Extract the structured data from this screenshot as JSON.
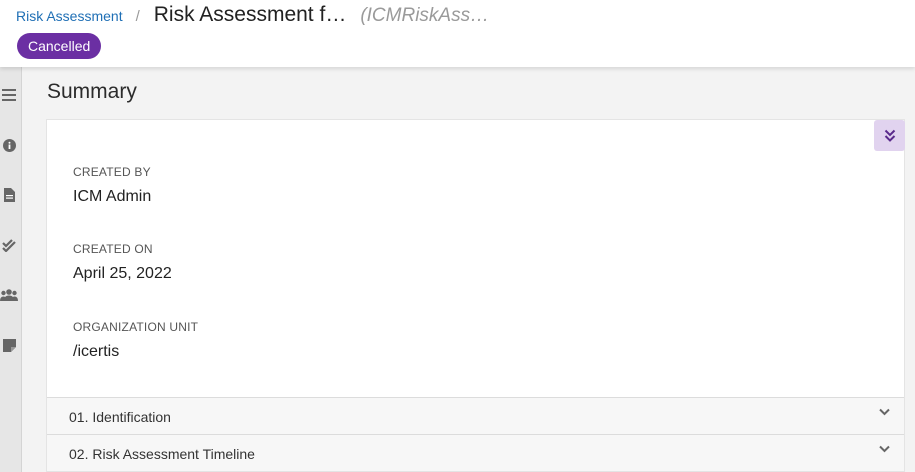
{
  "breadcrumb": {
    "parent_label": "Risk Assessment",
    "separator": "/",
    "title": "Risk Assessment f…",
    "subtitle": "(ICMRiskAss…"
  },
  "status": {
    "label": "Cancelled",
    "color": "#6b2fa3"
  },
  "left_rail": {
    "icons": [
      "menu-icon",
      "info-icon",
      "document-icon",
      "double-check-icon",
      "users-icon",
      "note-icon"
    ]
  },
  "summary": {
    "title": "Summary",
    "collapse_icon": "double-chevron-down-icon",
    "fields": [
      {
        "label": "CREATED BY",
        "value": "ICM Admin"
      },
      {
        "label": "CREATED ON",
        "value": "April 25, 2022"
      },
      {
        "label": "ORGANIZATION UNIT",
        "value": "/icertis"
      }
    ]
  },
  "accordions": [
    {
      "label": "01. Identification"
    },
    {
      "label": "02. Risk Assessment Timeline"
    }
  ],
  "colors": {
    "accent": "#6b2fa3",
    "link": "#1f6fb5",
    "collapse_bg": "#e1d3ef"
  }
}
